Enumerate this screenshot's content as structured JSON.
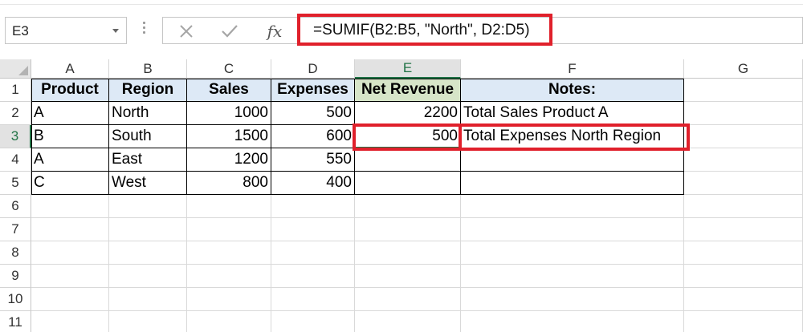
{
  "name_box": "E3",
  "formula_bar": {
    "fx_label": "fx",
    "formula": "=SUMIF(B2:B5, \"North\", D2:D5)"
  },
  "columns": [
    "A",
    "B",
    "C",
    "D",
    "E",
    "F",
    "G"
  ],
  "rows": [
    "1",
    "2",
    "3",
    "4",
    "5",
    "6",
    "7",
    "8",
    "9",
    "10",
    "11"
  ],
  "table": {
    "headers": [
      "Product",
      "Region",
      "Sales",
      "Expenses",
      "Net Revenue",
      "Notes:"
    ],
    "data": [
      [
        "A",
        "North",
        "1000",
        "500",
        "2200",
        "Total Sales Product A"
      ],
      [
        "B",
        "South",
        "1500",
        "600",
        "500",
        "Total Expenses North Region"
      ],
      [
        "A",
        "East",
        "1200",
        "550",
        "",
        ""
      ],
      [
        "C",
        "West",
        "800",
        "400",
        "",
        ""
      ]
    ]
  },
  "colors": {
    "header_fill": "#dde9f6",
    "net_revenue_header_fill": "#d6e5c8",
    "highlight": "#e0202b",
    "selection": "#217346"
  }
}
